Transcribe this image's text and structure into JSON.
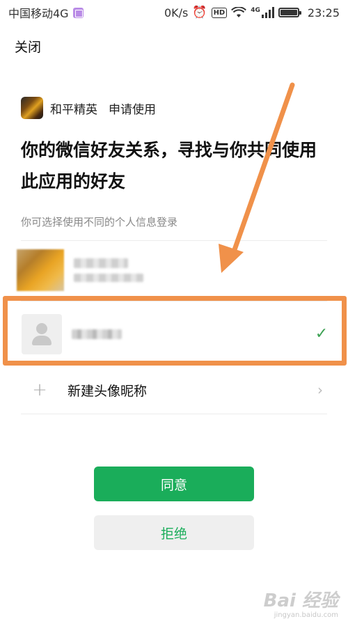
{
  "status_bar": {
    "carrier": "中国移动4G",
    "net_speed": "0K/s",
    "hd": "HD",
    "signal_type": "4G",
    "time": "23:25"
  },
  "header": {
    "close_label": "关闭"
  },
  "app": {
    "name": "和平精英",
    "request": "申请使用"
  },
  "title": "你的微信好友关系，寻找与你共同使用此应用的好友",
  "subtitle": "你可选择使用不同的个人信息登录",
  "accounts": {
    "new_profile_label": "新建头像昵称"
  },
  "buttons": {
    "agree": "同意",
    "reject": "拒绝"
  },
  "watermark": {
    "brand": "Bai 经验",
    "url": "jingyan.baidu.com"
  },
  "colors": {
    "accent_green": "#1aad5a",
    "highlight_orange": "#f0914a",
    "check_green": "#3da153"
  }
}
